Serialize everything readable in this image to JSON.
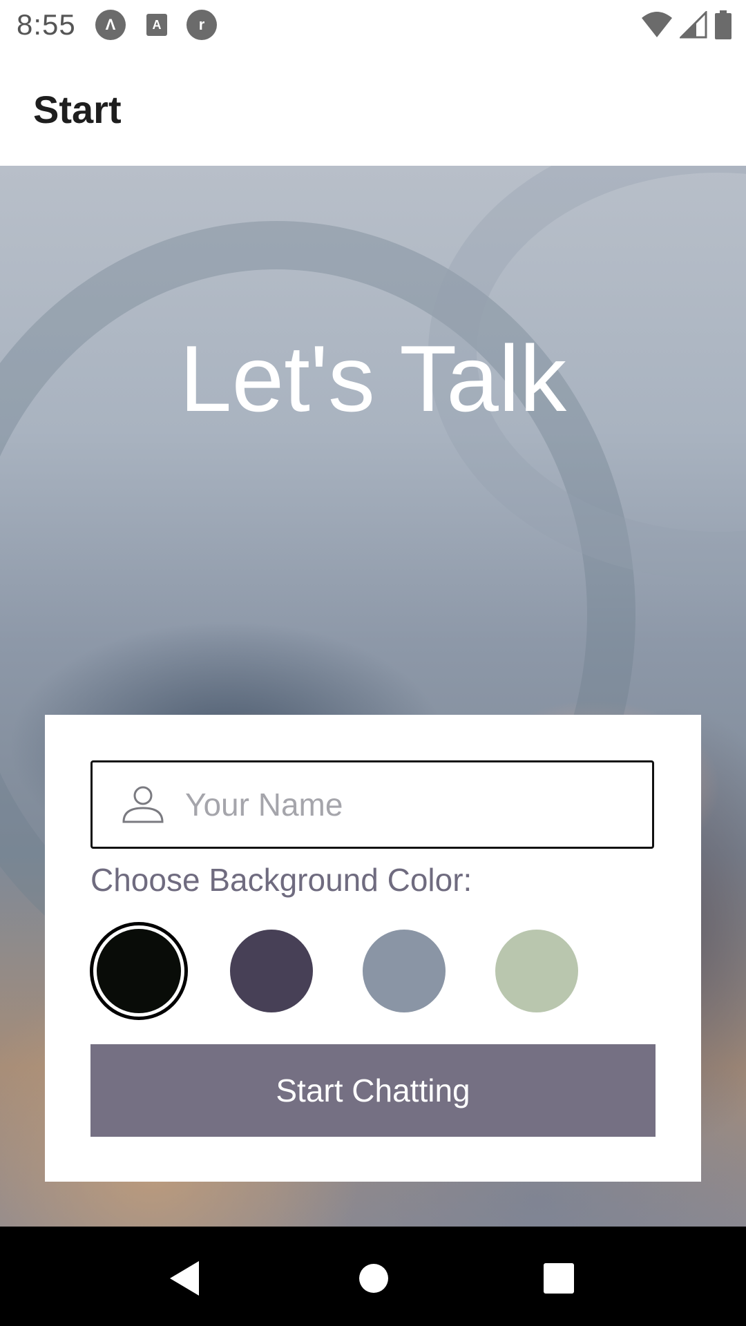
{
  "status_bar": {
    "time": "8:55",
    "left_icons": [
      {
        "icon": "launcher-app-icon",
        "glyph": "Λ"
      },
      {
        "icon": "text-accessibility-icon",
        "glyph": "A"
      },
      {
        "icon": "app-notification-icon",
        "glyph": "r"
      }
    ],
    "right_icons": [
      "wifi-icon",
      "cell-signal-icon",
      "battery-icon"
    ]
  },
  "app_bar": {
    "title": "Start"
  },
  "hero": {
    "title": "Let's Talk"
  },
  "form": {
    "name_placeholder": "Your Name",
    "name_value": "",
    "color_label": "Choose Background Color:",
    "colors": [
      {
        "name": "black",
        "hex": "#090C08",
        "selected": true
      },
      {
        "name": "dark-purple",
        "hex": "#474056",
        "selected": false
      },
      {
        "name": "slate-blue",
        "hex": "#8A95A5",
        "selected": false
      },
      {
        "name": "sage-green",
        "hex": "#B9C6AE",
        "selected": false
      }
    ],
    "button_label": "Start Chatting",
    "button_color": "#757083"
  },
  "nav_bar": {
    "items": [
      "back-icon",
      "home-icon",
      "recents-icon"
    ]
  }
}
